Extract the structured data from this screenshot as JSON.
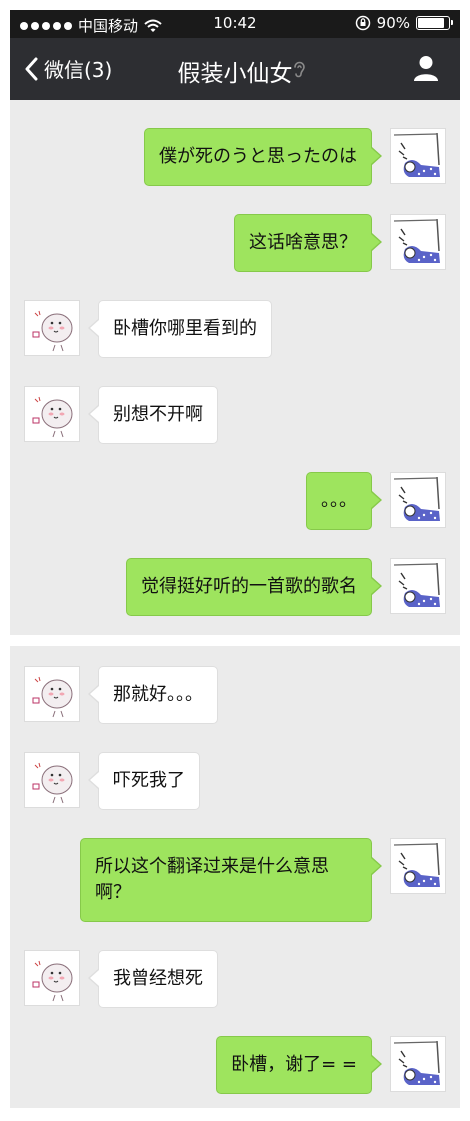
{
  "status_bar": {
    "carrier": "中国移动",
    "time": "10:42",
    "battery_percent": "90%",
    "battery_level": 0.9,
    "signal_icon": "signal-dots-icon",
    "wifi_icon": "wifi-icon",
    "rotation_lock_icon": "rotation-lock-icon"
  },
  "nav": {
    "back_label": "微信(3)",
    "title": "假装小仙女",
    "back_icon": "chevron-left-icon",
    "ear_icon": "ear-icon",
    "profile_icon": "person-icon"
  },
  "colors": {
    "sent_bubble": "#9ee45e",
    "received_bubble": "#ffffff",
    "chat_background": "#ebebeb",
    "nav_background": "#2d2e32"
  },
  "messages_panel1": [
    {
      "side": "right",
      "text": "僕が死のうと思ったのは"
    },
    {
      "side": "right",
      "text": "这话啥意思？"
    },
    {
      "side": "left",
      "text": "卧槽你哪里看到的"
    },
    {
      "side": "left",
      "text": "别想不开啊"
    },
    {
      "side": "right",
      "text": "。。。"
    },
    {
      "side": "right",
      "text": "觉得挺好听的一首歌的歌名"
    }
  ],
  "messages_panel2": [
    {
      "side": "left",
      "text": "那就好。。。"
    },
    {
      "side": "left",
      "text": "吓死我了"
    },
    {
      "side": "right",
      "text": "所以这个翻译过来是什么意思啊？"
    },
    {
      "side": "left",
      "text": "我曾经想死"
    },
    {
      "side": "right",
      "text": "卧槽，谢了= ="
    }
  ]
}
